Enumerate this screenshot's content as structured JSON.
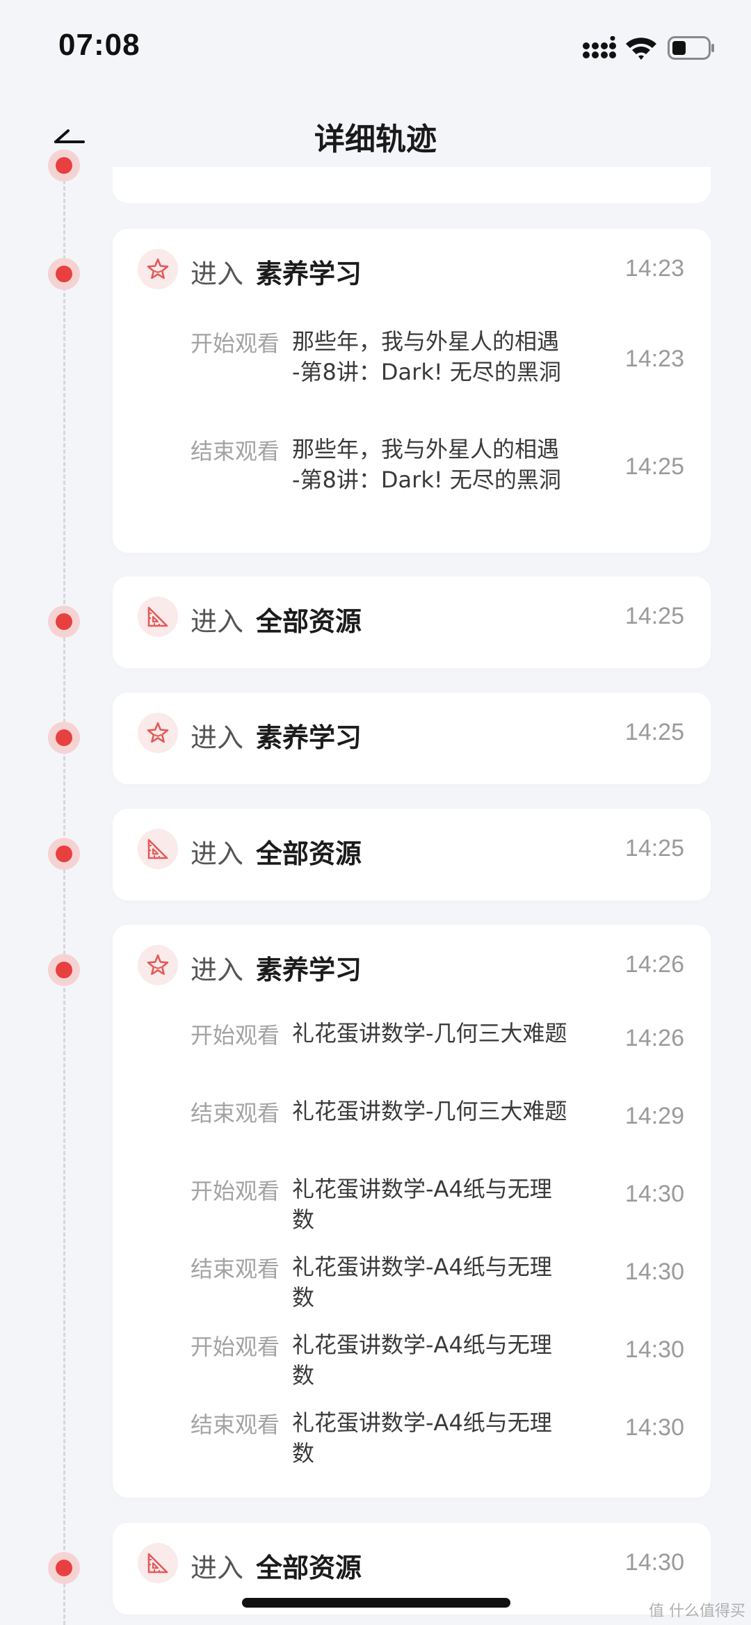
{
  "status_bar": {
    "time": "07:08",
    "icons": [
      "signal-icon",
      "wifi-icon",
      "battery-icon"
    ],
    "battery_level": 0.4
  },
  "nav": {
    "title": "详细轨迹",
    "back_icon": "back-arrow-icon"
  },
  "colors": {
    "dot": "#e8403f",
    "dot_halo": "#f6d3d3",
    "icon_bg": "#fbeaea",
    "icon_stroke": "#e35a58",
    "background": "#f4f5f9"
  },
  "cards": [
    {
      "icon": "star-icon",
      "action": "进入",
      "target": "素养学习",
      "time": "14:23",
      "events": [
        {
          "action": "开始观看",
          "text": "那些年，我与外星人的相遇 -第8讲：Dark! 无尽的黑洞",
          "time": "14:23"
        },
        {
          "action": "结束观看",
          "text": "那些年，我与外星人的相遇 -第8讲：Dark! 无尽的黑洞",
          "time": "14:25"
        }
      ]
    },
    {
      "icon": "ruler-triangle-icon",
      "action": "进入",
      "target": "全部资源",
      "time": "14:25",
      "events": []
    },
    {
      "icon": "star-icon",
      "action": "进入",
      "target": "素养学习",
      "time": "14:25",
      "events": []
    },
    {
      "icon": "ruler-triangle-icon",
      "action": "进入",
      "target": "全部资源",
      "time": "14:25",
      "events": []
    },
    {
      "icon": "star-icon",
      "action": "进入",
      "target": "素养学习",
      "time": "14:26",
      "events": [
        {
          "action": "开始观看",
          "text": "礼花蛋讲数学-几何三大难题",
          "time": "14:26"
        },
        {
          "action": "结束观看",
          "text": "礼花蛋讲数学-几何三大难题",
          "time": "14:29"
        },
        {
          "action": "开始观看",
          "text": "礼花蛋讲数学-A4纸与无理数",
          "time": "14:30"
        },
        {
          "action": "结束观看",
          "text": "礼花蛋讲数学-A4纸与无理数",
          "time": "14:30"
        },
        {
          "action": "开始观看",
          "text": "礼花蛋讲数学-A4纸与无理数",
          "time": "14:30"
        },
        {
          "action": "结束观看",
          "text": "礼花蛋讲数学-A4纸与无理数",
          "time": "14:30"
        }
      ]
    },
    {
      "icon": "ruler-triangle-icon",
      "action": "进入",
      "target": "全部资源",
      "time": "14:30",
      "events": []
    }
  ],
  "watermark": "值 什么值得买"
}
